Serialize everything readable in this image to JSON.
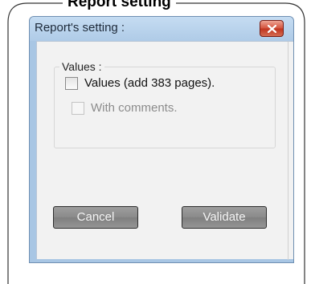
{
  "frame": {
    "title": "Report setting"
  },
  "dialog": {
    "title": "Report's setting :",
    "close_icon": "close-icon"
  },
  "group": {
    "legend": "Values :",
    "options": [
      {
        "label": "Values (add 383 pages).",
        "checked": false,
        "enabled": true
      },
      {
        "label": "With comments.",
        "checked": false,
        "enabled": false
      }
    ]
  },
  "buttons": {
    "cancel_label": "Cancel",
    "validate_label": "Validate"
  },
  "colors": {
    "titlebar": "#afcbe7",
    "close_button": "#c1341e",
    "client_background": "#f2f2f2",
    "button_gray": "#8a8a8a"
  }
}
